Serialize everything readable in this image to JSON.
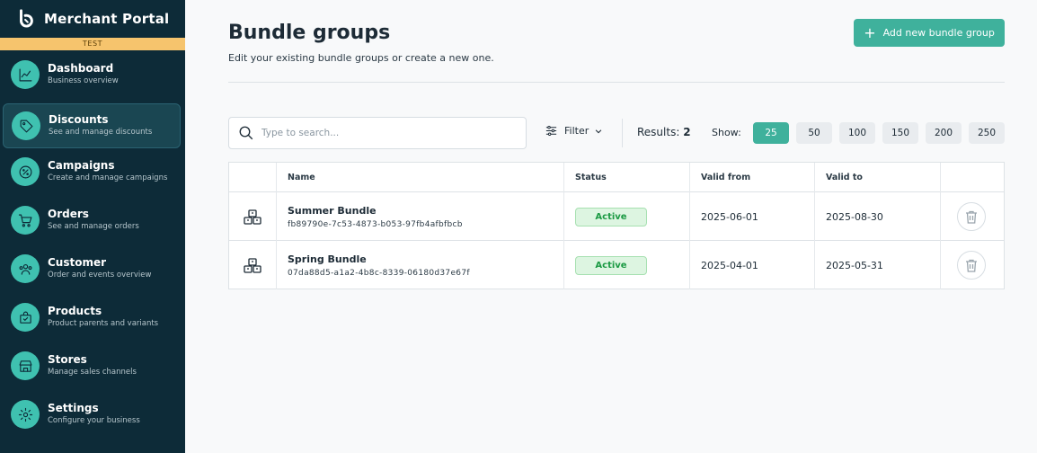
{
  "app": {
    "title": "Merchant Portal",
    "environment": "TEST",
    "logo_icon": "brand-logo-icon"
  },
  "sidebar": {
    "items": [
      {
        "label": "Dashboard",
        "sub": "Business overview",
        "icon": "chart-icon",
        "active": false
      },
      {
        "label": "Discounts",
        "sub": "See and manage discounts",
        "icon": "tag-icon",
        "active": true
      },
      {
        "label": "Campaigns",
        "sub": "Create and manage campaigns",
        "icon": "percent-icon",
        "active": false
      },
      {
        "label": "Orders",
        "sub": "See and manage orders",
        "icon": "cart-icon",
        "active": false
      },
      {
        "label": "Customer",
        "sub": "Order and events overview",
        "icon": "users-icon",
        "active": false
      },
      {
        "label": "Products",
        "sub": "Product parents and variants",
        "icon": "bag-icon",
        "active": false
      },
      {
        "label": "Stores",
        "sub": "Manage sales channels",
        "icon": "store-icon",
        "active": false
      },
      {
        "label": "Settings",
        "sub": "Configure your business",
        "icon": "gear-icon",
        "active": false
      }
    ]
  },
  "header": {
    "title": "Bundle groups",
    "subtitle": "Edit your existing bundle groups or create a new one.",
    "add_button": "Add new bundle group"
  },
  "toolbar": {
    "search_placeholder": "Type to search...",
    "search_value": "",
    "filter_label": "Filter",
    "results_label": "Results:",
    "results_count": "2",
    "show_label": "Show:",
    "page_sizes": [
      "25",
      "50",
      "100",
      "150",
      "200",
      "250"
    ],
    "selected_page_size": "25"
  },
  "table": {
    "columns": [
      "Name",
      "Status",
      "Valid from",
      "Valid to"
    ],
    "rows": [
      {
        "name": "Summer Bundle",
        "id": "fb89790e-7c53-4873-b053-97fb4afbfbcb",
        "status": "Active",
        "valid_from": "2025-06-01",
        "valid_to": "2025-08-30"
      },
      {
        "name": "Spring Bundle",
        "id": "07da88d5-a1a2-4b8c-8339-06180d37e67f",
        "status": "Active",
        "valid_from": "2025-04-01",
        "valid_to": "2025-05-31"
      }
    ]
  },
  "colors": {
    "sidebar_bg": "#0d2b38",
    "accent": "#3fb19c",
    "env_bar": "#f6c46d",
    "status_active_bg": "#ddf5e1",
    "status_active_text": "#1c9a44"
  }
}
